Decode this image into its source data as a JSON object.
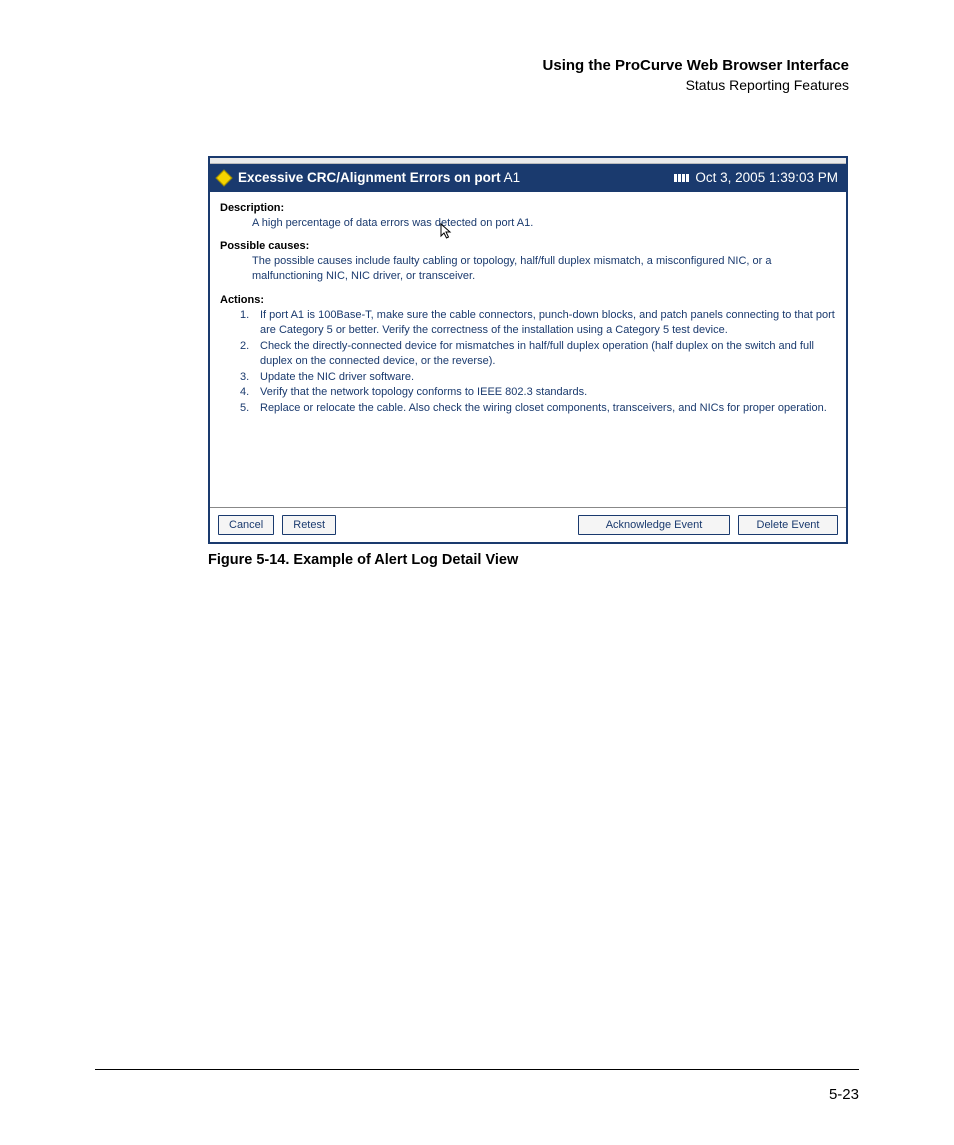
{
  "header": {
    "title": "Using the ProCurve Web Browser Interface",
    "subtitle": "Status Reporting Features"
  },
  "dialog": {
    "title_bold": "Excessive CRC/Alignment Errors on port",
    "title_suffix": " A1",
    "timestamp": "Oct 3, 2005 1:39:03 PM",
    "sections": {
      "description_heading": "Description:",
      "description_text": "A high percentage of data errors was detected on port A1.",
      "causes_heading": "Possible causes:",
      "causes_text": "The possible causes include faulty cabling or topology, half/full duplex mismatch, a misconfigured NIC, or a malfunctioning NIC, NIC driver, or transceiver.",
      "actions_heading": "Actions:",
      "actions": [
        "If port A1 is 100Base-T, make sure the cable connectors, punch-down blocks, and patch panels connecting to that port are Category 5 or better. Verify the correctness of the installation using a Category 5 test device.",
        "Check the directly-connected device for mismatches in half/full duplex operation (half duplex on the switch and full duplex on the connected device, or the reverse).",
        "Update the NIC driver software.",
        "Verify that the network topology conforms to IEEE 802.3 standards.",
        "Replace or relocate the cable. Also check the wiring closet components, transceivers, and NICs for proper operation."
      ]
    },
    "buttons": {
      "cancel": "Cancel",
      "retest": "Retest",
      "acknowledge": "Acknowledge Event",
      "delete": "Delete Event"
    }
  },
  "caption": "Figure 5-14. Example of Alert Log Detail View",
  "page_number": "5-23"
}
